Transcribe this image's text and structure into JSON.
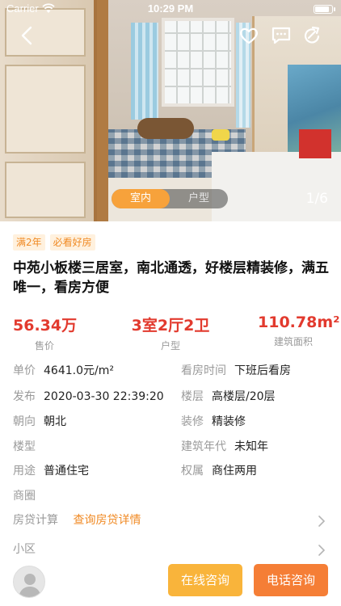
{
  "status_bar": {
    "carrier": "Carrier",
    "time": "10:29 PM"
  },
  "icons": {
    "back": "chevron-left-icon",
    "favorite": "heart-icon",
    "message": "chat-bubble-icon",
    "share": "share-icon"
  },
  "photo": {
    "tabs": [
      "室内",
      "户型"
    ],
    "active_tab": "室内",
    "counter": "1/6"
  },
  "tags": [
    "满2年",
    "必看好房"
  ],
  "title": "中苑小板楼三居室，南北通透，好楼层精装修，满五唯一，看房方便",
  "stats": {
    "price": {
      "value": "56.34万",
      "label": "售价"
    },
    "layout": {
      "value": "3室2厅2卫",
      "label": "户型"
    },
    "area": {
      "value": "110.78m²",
      "label": "建筑面积"
    }
  },
  "attributes": [
    {
      "left": {
        "key": "单价",
        "value": "4641.0元/m²"
      },
      "right": {
        "key": "看房时间",
        "value": "下班后看房"
      }
    },
    {
      "left": {
        "key": "发布",
        "value": "2020-03-30 22:39:20"
      },
      "right": {
        "key": "楼层",
        "value": "高楼层/20层"
      }
    },
    {
      "left": {
        "key": "朝向",
        "value": "朝北"
      },
      "right": {
        "key": "装修",
        "value": "精装修"
      }
    },
    {
      "left": {
        "key": "楼型",
        "value": ""
      },
      "right": {
        "key": "建筑年代",
        "value": "未知年"
      }
    },
    {
      "left": {
        "key": "用途",
        "value": "普通住宅"
      },
      "right": {
        "key": "权属",
        "value": "商住两用"
      }
    },
    {
      "left": {
        "key": "商圈",
        "value": ""
      },
      "right": {
        "key": "",
        "value": ""
      }
    }
  ],
  "mortgage": {
    "key": "房贷计算",
    "link": "查询房贷详情"
  },
  "community": {
    "key": "小区"
  },
  "actions": {
    "online": "在线咨询",
    "phone": "电话咨询"
  },
  "colors": {
    "accent": "#f08a24",
    "price_red": "#e23a2e",
    "online_btn": "#f9b43b",
    "phone_btn": "#f57e36"
  }
}
